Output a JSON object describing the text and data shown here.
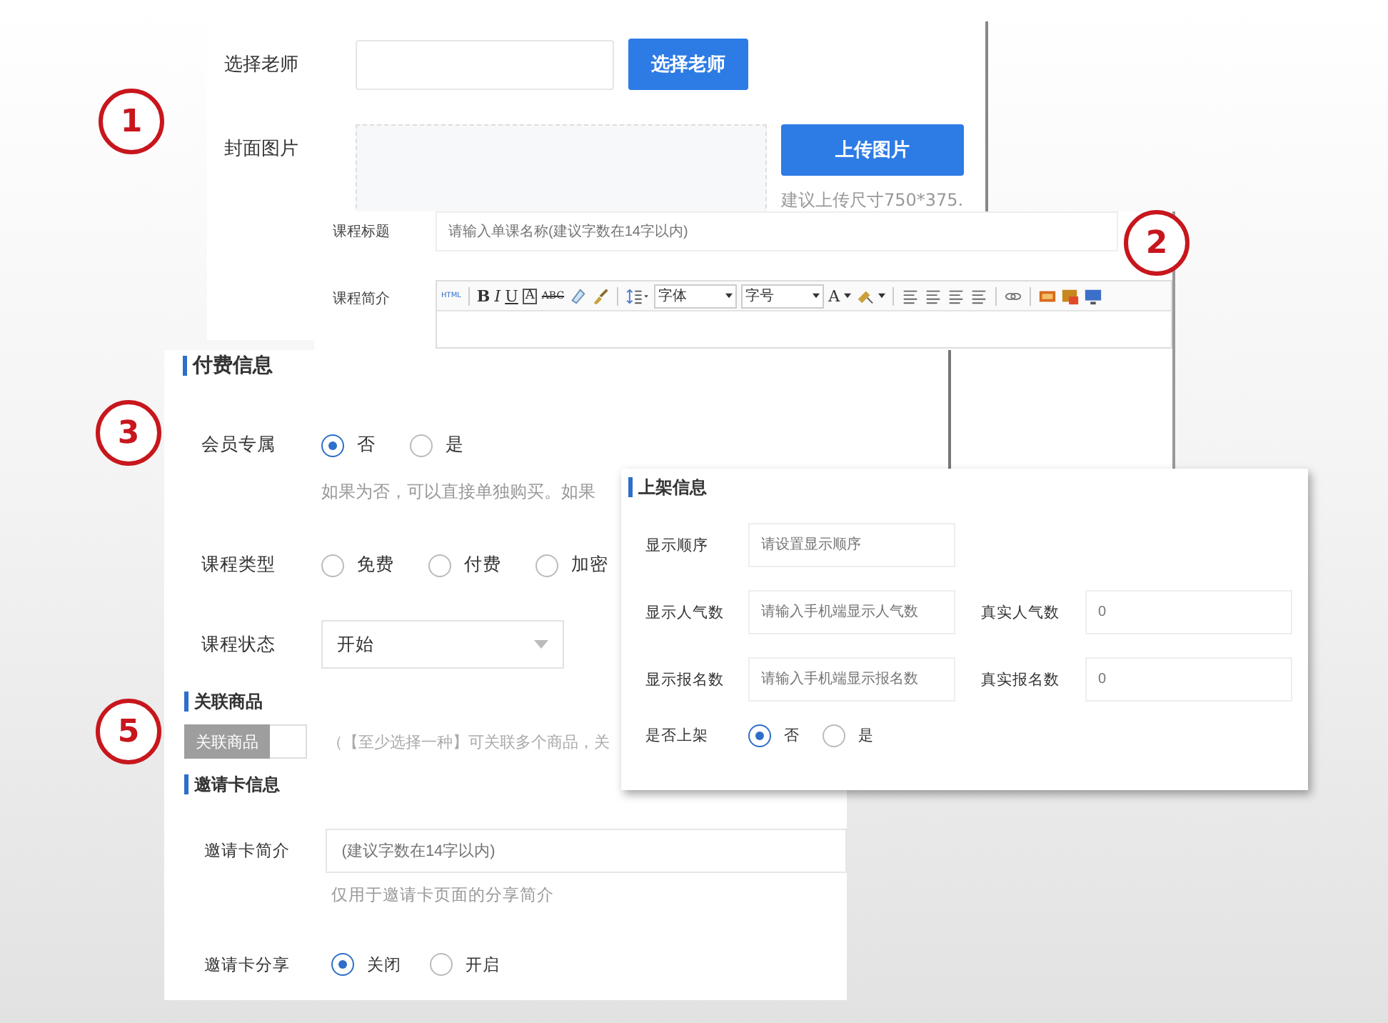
{
  "markers": [
    {
      "label": "1"
    },
    {
      "label": "2"
    },
    {
      "label": "3"
    },
    {
      "label": "5"
    }
  ],
  "basic_panel": {
    "teacher": {
      "label": "选择老师",
      "button": "选择老师"
    },
    "cover": {
      "label": "封面图片",
      "button": "上传图片",
      "hint": "建议上传尺寸750*375."
    }
  },
  "course_panel": {
    "title": {
      "label": "课程标题",
      "placeholder": "请输入单课名称(建议字数在14字以内)"
    },
    "intro": {
      "label": "课程简介",
      "toolbar": {
        "html": "HTML",
        "bold": "B",
        "italic": "I",
        "underline": "U",
        "boxed": "A",
        "strike": "ABC",
        "font": "字体",
        "size": "字号",
        "text_color": "A"
      }
    }
  },
  "payment_panel": {
    "heading": "付费信息",
    "member_only": {
      "label": "会员专属",
      "options": [
        {
          "label": "否",
          "selected": true
        },
        {
          "label": "是",
          "selected": false
        }
      ],
      "hint": "如果为否，可以直接单独购买。如果"
    },
    "course_type": {
      "label": "课程类型",
      "options": [
        {
          "label": "免费",
          "selected": false
        },
        {
          "label": "付费",
          "selected": false
        },
        {
          "label": "加密",
          "selected": false
        }
      ]
    },
    "status": {
      "label": "课程状态",
      "value": "开始"
    }
  },
  "listing_panel": {
    "heading": "上架信息",
    "rows": [
      {
        "fields": [
          {
            "label": "显示顺序",
            "placeholder": "请设置显示顺序"
          }
        ]
      },
      {
        "fields": [
          {
            "label": "显示人气数",
            "placeholder": "请输入手机端显示人气数"
          },
          {
            "label": "真实人气数",
            "placeholder": "0"
          }
        ]
      },
      {
        "fields": [
          {
            "label": "显示报名数",
            "placeholder": "请输入手机端显示报名数"
          },
          {
            "label": "真实报名数",
            "placeholder": "0"
          }
        ]
      }
    ],
    "on_shelf": {
      "label": "是否上架",
      "options": [
        {
          "label": "否",
          "selected": true
        },
        {
          "label": "是",
          "selected": false
        }
      ]
    }
  },
  "related_panel": {
    "heading": "关联商品",
    "button": "关联商品",
    "hint": "（【至少选择一种】可关联多个商品，关",
    "invite": {
      "heading": "邀请卡信息",
      "intro": {
        "label": "邀请卡简介",
        "placeholder": "(建议字数在14字以内)",
        "hint": "仅用于邀请卡页面的分享简介"
      },
      "share": {
        "label": "邀请卡分享",
        "options": [
          {
            "label": "关闭",
            "selected": true
          },
          {
            "label": "开启",
            "selected": false
          }
        ]
      }
    }
  }
}
